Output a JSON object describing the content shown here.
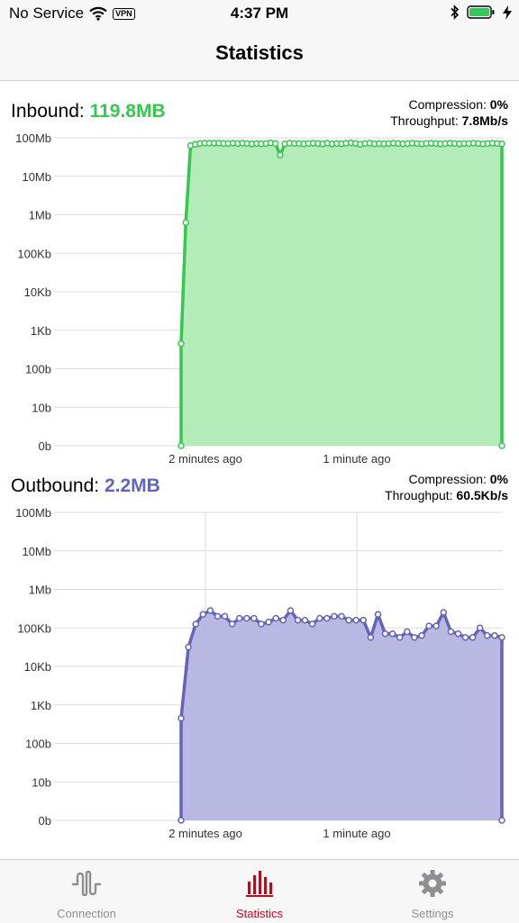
{
  "status_bar": {
    "carrier": "No Service",
    "vpn": "VPN",
    "time": "4:37 PM"
  },
  "nav": {
    "title": "Statistics"
  },
  "inbound": {
    "label": "Inbound:",
    "total": "119.8MB",
    "compression_label": "Compression:",
    "compression": "0%",
    "throughput_label": "Throughput:",
    "throughput": "7.8Mb/s",
    "color": "#35c74e",
    "fill": "#b3ebb9"
  },
  "outbound": {
    "label": "Outbound:",
    "total": "2.2MB",
    "compression_label": "Compression:",
    "compression": "0%",
    "throughput_label": "Throughput:",
    "throughput": "60.5Kb/s",
    "color": "#6464b9",
    "fill": "#b8b8e2"
  },
  "tabs": [
    {
      "label": "Connection",
      "icon": "waveform-icon",
      "active": false
    },
    {
      "label": "Statistics",
      "icon": "bar-chart-icon",
      "active": true
    },
    {
      "label": "Settings",
      "icon": "gear-icon",
      "active": false
    }
  ],
  "colors": {
    "active_tab": "#d0021b",
    "inactive_tab": "#8e8e93"
  },
  "chart_data": [
    {
      "type": "area",
      "scale": "log",
      "y_tick_labels": [
        "0b",
        "10b",
        "100b",
        "1Kb",
        "10Kb",
        "100Kb",
        "1Mb",
        "10Mb",
        "100Mb"
      ],
      "x_tick_labels": [
        "2 minutes ago",
        "1 minute ago"
      ],
      "grid": true,
      "values_log10": [
        2.65,
        5.8,
        7.8,
        7.83,
        7.85,
        7.86,
        7.86,
        7.86,
        7.86,
        7.85,
        7.85,
        7.86,
        7.85,
        7.86,
        7.85,
        7.84,
        7.85,
        7.84,
        7.85,
        7.87,
        7.85,
        7.55,
        7.84,
        7.86,
        7.85,
        7.85,
        7.84,
        7.85,
        7.86,
        7.85,
        7.84,
        7.86,
        7.84,
        7.85,
        7.84,
        7.86,
        7.87,
        7.85,
        7.83,
        7.85,
        7.86,
        7.84,
        7.85,
        7.84,
        7.85,
        7.86,
        7.85,
        7.84,
        7.85,
        7.86,
        7.85,
        7.84,
        7.85,
        7.86,
        7.85,
        7.84,
        7.85,
        7.86,
        7.85,
        7.84,
        7.85,
        7.85,
        7.86,
        7.85,
        7.84,
        7.85,
        7.86,
        7.85,
        7.84
      ]
    },
    {
      "type": "area",
      "scale": "log",
      "y_tick_labels": [
        "0b",
        "10b",
        "100b",
        "1Kb",
        "10Kb",
        "100Kb",
        "1Mb",
        "10Mb",
        "100Mb"
      ],
      "x_tick_labels": [
        "2 minutes ago",
        "1 minute ago"
      ],
      "grid": true,
      "values_log10": [
        2.65,
        4.5,
        5.1,
        5.35,
        5.45,
        5.3,
        5.3,
        5.1,
        5.25,
        5.25,
        5.25,
        5.1,
        5.15,
        5.25,
        5.2,
        5.45,
        5.2,
        5.2,
        5.1,
        5.25,
        5.25,
        5.3,
        5.3,
        5.2,
        5.2,
        5.2,
        4.75,
        5.35,
        4.85,
        4.85,
        4.75,
        4.9,
        4.75,
        4.8,
        5.05,
        5.05,
        5.4,
        4.9,
        4.85,
        4.75,
        4.75,
        5.0,
        4.8,
        4.8,
        4.75
      ]
    }
  ]
}
